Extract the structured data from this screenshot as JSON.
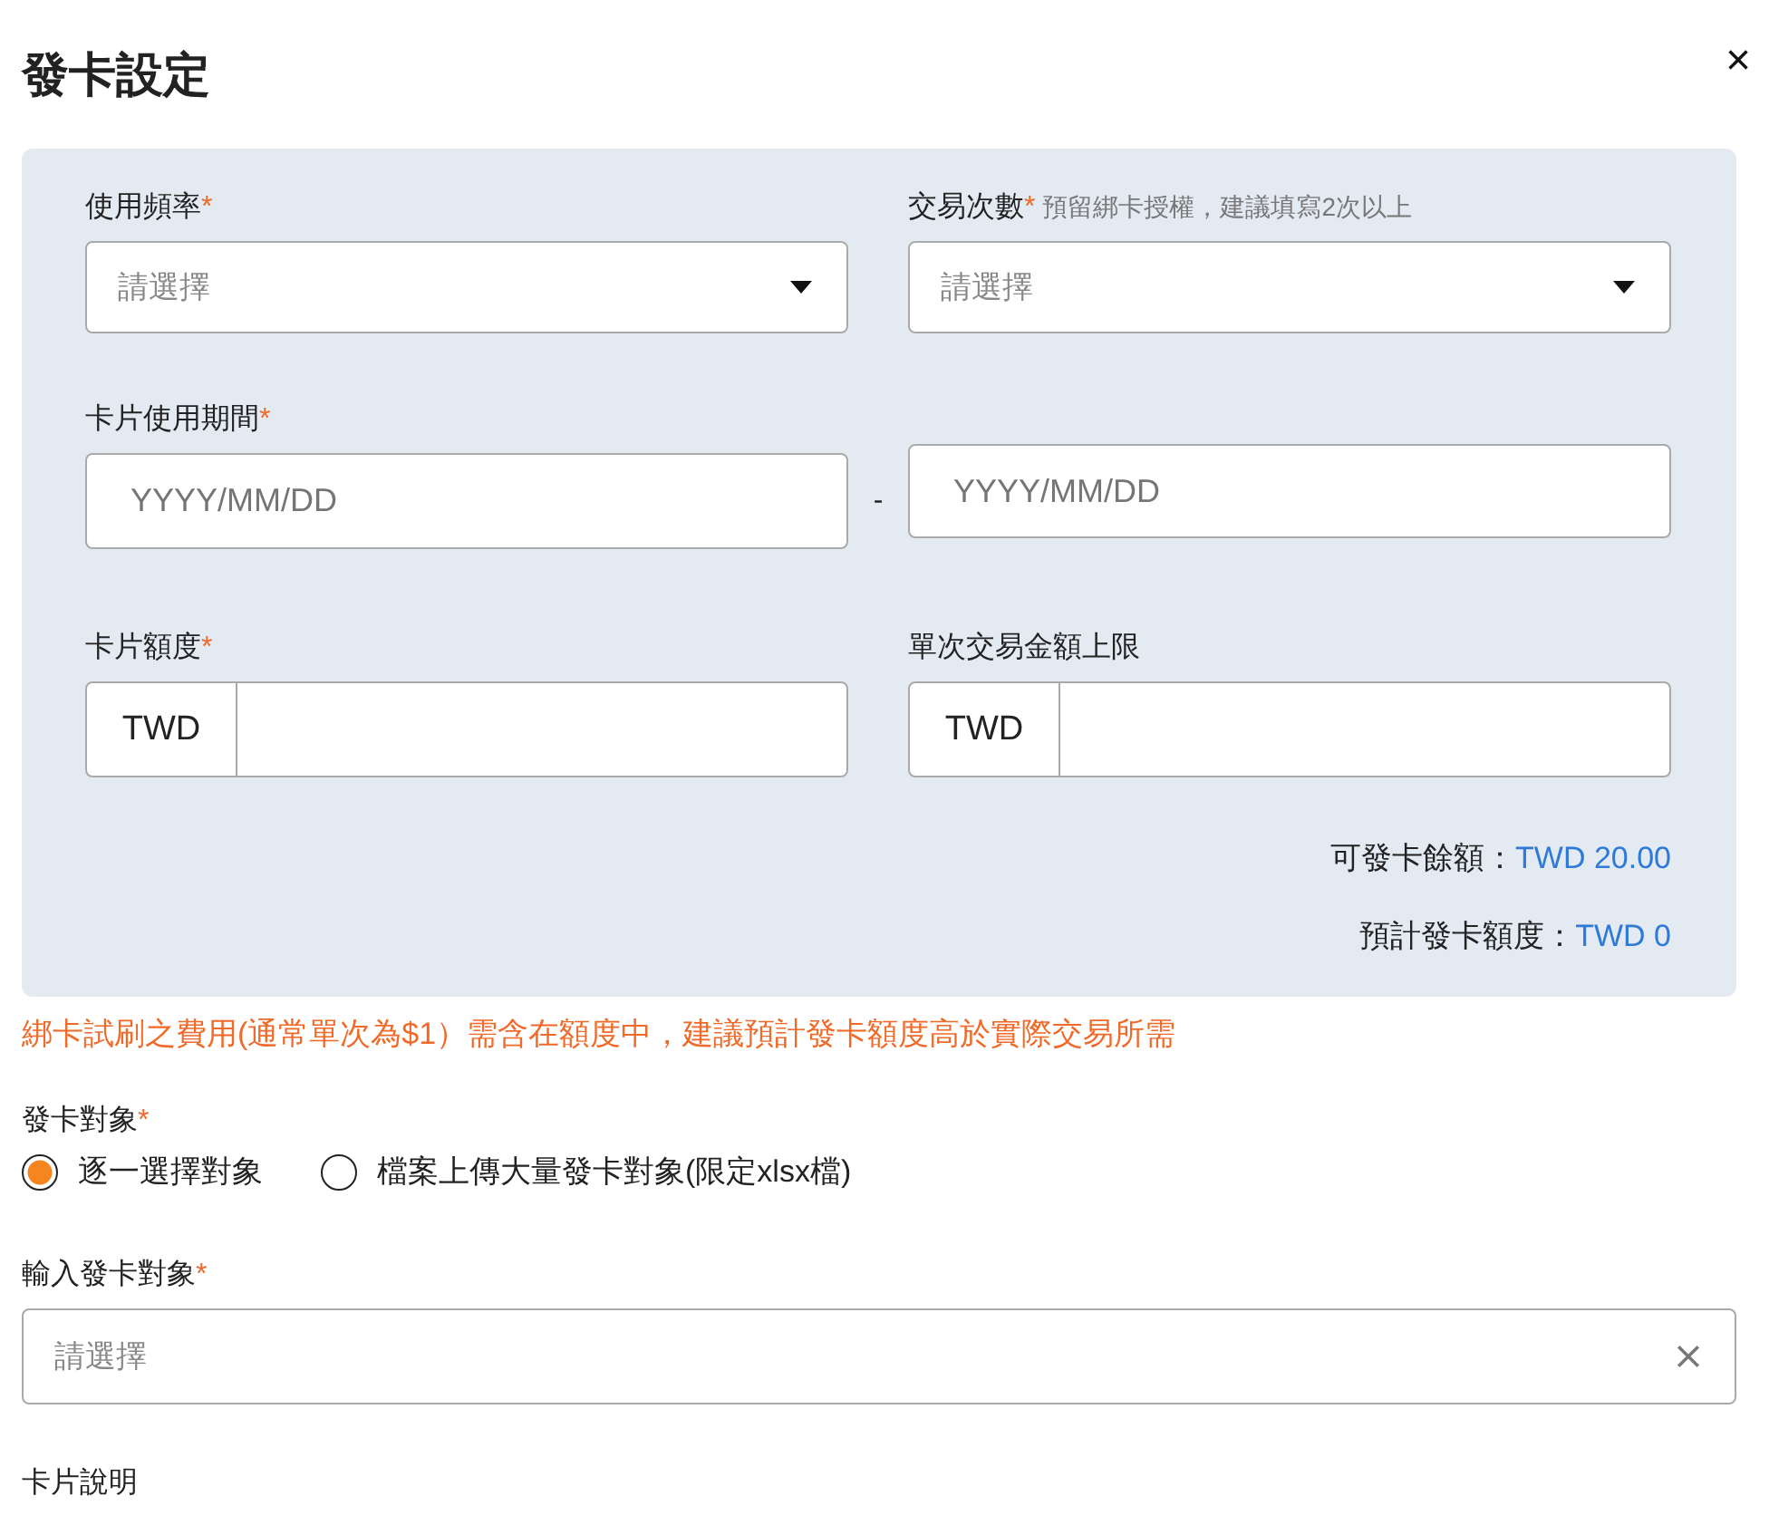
{
  "dialog": {
    "title": "發卡設定",
    "close": "×"
  },
  "panel": {
    "rows": [
      {
        "kind": "pair",
        "fields": [
          {
            "kind": "select",
            "label": "使用頻率",
            "required_mark": "*",
            "placeholder": "請選擇"
          },
          {
            "kind": "select",
            "label": "交易次數",
            "required_mark": "*",
            "hint": "預留綁卡授權，建議填寫2次以上",
            "placeholder": "請選擇"
          }
        ]
      },
      {
        "kind": "date_range",
        "label": "卡片使用期間",
        "required_mark": "*",
        "start_placeholder": "YYYY/MM/DD",
        "separator": "-",
        "end_placeholder": "YYYY/MM/DD"
      },
      {
        "kind": "pair",
        "fields": [
          {
            "kind": "currency",
            "label": "卡片額度",
            "required_mark": "*",
            "prefix": "TWD"
          },
          {
            "kind": "currency",
            "label": "單次交易金額上限",
            "prefix": "TWD"
          }
        ]
      }
    ],
    "summary": [
      {
        "label": "可發卡餘額：",
        "value": "TWD 20.00"
      },
      {
        "label": "預計發卡額度：",
        "value": "TWD 0"
      }
    ]
  },
  "warning": "綁卡試刷之費用(通常單次為$1）需含在額度中，建議預計發卡額度高於實際交易所需",
  "target": {
    "label": "發卡對象",
    "required_mark": "*",
    "options": [
      {
        "label": "逐一選擇對象",
        "selected": true
      },
      {
        "label": "檔案上傳大量發卡對象(限定xlsx檔)",
        "selected": false
      }
    ]
  },
  "target_input": {
    "label": "輸入發卡對象",
    "required_mark": "*",
    "placeholder": "請選擇"
  },
  "description": {
    "label": "卡片說明"
  }
}
